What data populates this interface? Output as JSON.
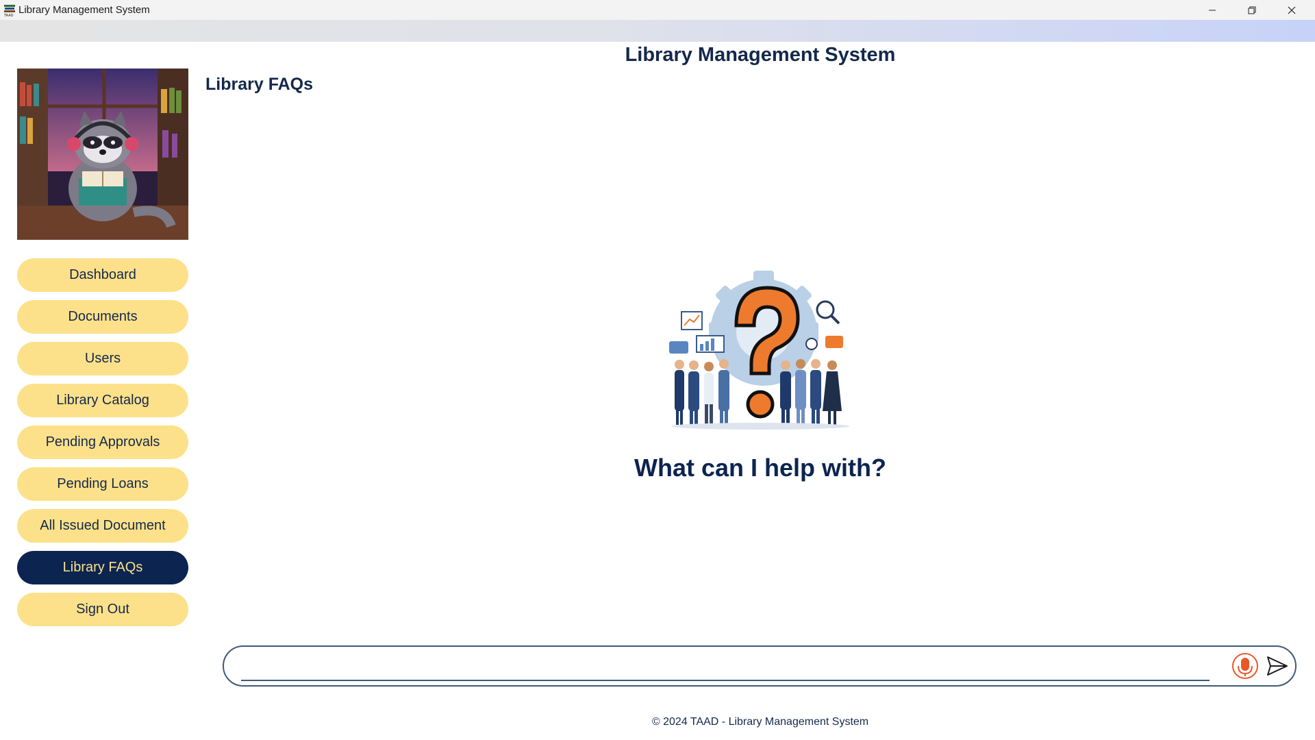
{
  "window": {
    "title": "Library Management System"
  },
  "header": {
    "app_title": "Library Management System",
    "page_title": "Library FAQs"
  },
  "sidebar": {
    "items": [
      {
        "label": "Dashboard",
        "active": false
      },
      {
        "label": "Documents",
        "active": false
      },
      {
        "label": "Users",
        "active": false
      },
      {
        "label": "Library Catalog",
        "active": false
      },
      {
        "label": "Pending Approvals",
        "active": false
      },
      {
        "label": "Pending Loans",
        "active": false
      },
      {
        "label": "All Issued Document",
        "active": false
      },
      {
        "label": "Library FAQs",
        "active": true
      },
      {
        "label": "Sign Out",
        "active": false
      }
    ]
  },
  "main": {
    "help_heading": "What can I help with?"
  },
  "chat": {
    "input_value": "",
    "placeholder": "",
    "mic_icon": "microphone-icon",
    "send_icon": "send-icon"
  },
  "footer": {
    "text": "© 2024 TAAD - Library Management System"
  },
  "colors": {
    "nav_inactive": "#fde18a",
    "nav_active": "#0c2450",
    "heading": "#14284b",
    "mic_accent": "#e8572a"
  }
}
